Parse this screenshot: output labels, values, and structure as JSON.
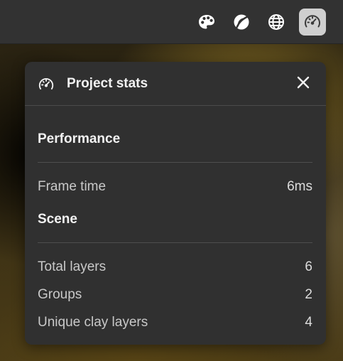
{
  "toolbar": {
    "icons": [
      "palette-icon",
      "leaf-icon",
      "globe-icon",
      "speedometer-icon"
    ],
    "active_icon": "speedometer-icon"
  },
  "panel": {
    "title": "Project stats",
    "header_icon": "speedometer-icon",
    "close_icon": "close-icon",
    "sections": {
      "performance": {
        "title": "Performance",
        "rows": [
          {
            "label": "Frame time",
            "value": "6ms"
          }
        ]
      },
      "scene": {
        "title": "Scene",
        "rows": [
          {
            "label": "Total layers",
            "value": "6"
          },
          {
            "label": "Groups",
            "value": "2"
          },
          {
            "label": "Unique clay layers",
            "value": "4"
          }
        ]
      }
    }
  },
  "colors": {
    "toolbar_bg": "#323232",
    "panel_bg": "#303030",
    "active_button_bg": "#cfcfcf",
    "text_primary": "#f2f2f2",
    "text_secondary": "#c9c9c9"
  }
}
